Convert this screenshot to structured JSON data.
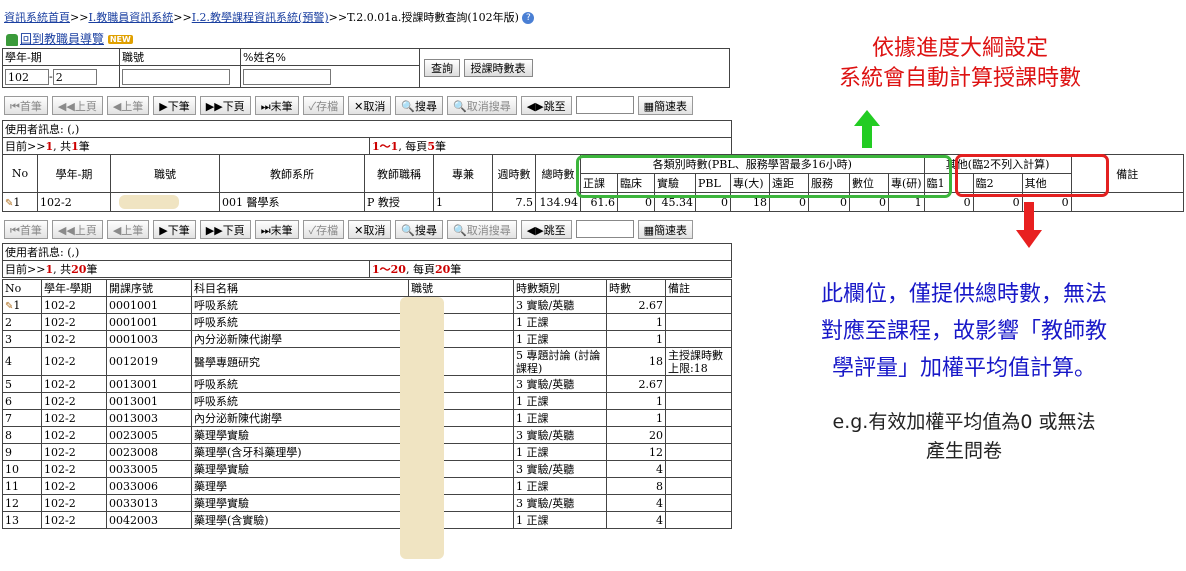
{
  "breadcrumb": {
    "items": [
      "資訊系統首頁",
      "I.教職員資訊系統",
      "I.2.教學課程資訊系統(預警)"
    ],
    "separator": ">>",
    "current": ">>T.2.0.01a.授課時數查詢(102年版)"
  },
  "back_link": {
    "label": "回到教職員導覽",
    "badge": "NEW"
  },
  "query": {
    "headers": [
      "學年-期",
      "職號",
      "%姓名%"
    ],
    "year_value": "102",
    "term_value": "2",
    "term_prefix": "-",
    "buttons": [
      "查詢",
      "授課時數表"
    ]
  },
  "toolbar": {
    "first": "首筆",
    "prev_page": "上頁",
    "prev": "上筆",
    "next": "下筆",
    "next_page": "下頁",
    "last": "末筆",
    "save": "存檔",
    "cancel": "取消",
    "search": "搜尋",
    "cancel_search": "取消搜尋",
    "goto": "跳至",
    "quick": "簡速表"
  },
  "top_status": {
    "user_msg": "使用者訊息: (,)",
    "position_prefix": "目前>>",
    "position": "1",
    "total_prefix": ", 共",
    "total": "1",
    "total_suffix": "筆",
    "range": "1～1",
    "per_page_prefix": ", 每頁",
    "per_page": "5",
    "per_page_suffix": "筆"
  },
  "teacher_table": {
    "headers": {
      "no": "No",
      "term": "學年-期",
      "id": "職號",
      "dept": "教師系所",
      "title": "教師職稱",
      "fulltime": "專兼",
      "week_hours": "週時數",
      "total_hours": "總時數",
      "group1": "各類別時數(PBL、服務學習最多16小時)",
      "group2": "其他(臨2不列入計算)",
      "remark": "備註"
    },
    "sub_headers1": [
      "正課",
      "臨床",
      "實驗",
      "PBL",
      "專(大)",
      "遠距",
      "服務",
      "數位",
      "專(研)"
    ],
    "sub_headers2": [
      "臨1",
      "臨2",
      "其他"
    ],
    "row": {
      "no": "1",
      "term": "102-2",
      "id": "",
      "dept": "001 醫學系",
      "title": "P 教授",
      "fulltime": "1",
      "week_hours": "7.5",
      "total_hours": "134.94",
      "cat": [
        "61.6",
        "0",
        "45.34",
        "0",
        "18",
        "0",
        "0",
        "0",
        "1"
      ],
      "other": [
        "0",
        "0",
        "0"
      ]
    }
  },
  "bottom_status": {
    "user_msg": "使用者訊息: (,)",
    "position_prefix": "目前>>",
    "position": "1",
    "total_prefix": ", 共",
    "total": "20",
    "total_suffix": "筆",
    "range": "1～20",
    "per_page_prefix": ", 每頁",
    "per_page": "20",
    "per_page_suffix": "筆"
  },
  "course_table": {
    "headers": [
      "No",
      "學年-學期",
      "開課序號",
      "科目名稱",
      "職號",
      "時數類別",
      "時數",
      "備註"
    ],
    "rows": [
      {
        "no": "1",
        "term": "102-2",
        "code": "0001001",
        "name": "呼吸系統",
        "type": "3 實驗/英聽",
        "hours": "2.67",
        "note": ""
      },
      {
        "no": "2",
        "term": "102-2",
        "code": "0001001",
        "name": "呼吸系統",
        "type": "1 正課",
        "hours": "1",
        "note": ""
      },
      {
        "no": "3",
        "term": "102-2",
        "code": "0001003",
        "name": "內分泌新陳代謝學",
        "type": "1 正課",
        "hours": "1",
        "note": ""
      },
      {
        "no": "4",
        "term": "102-2",
        "code": "0012019",
        "name": "醫學專題研究",
        "type": "5 專題討論 (討論課程)",
        "hours": "18",
        "note": "主授課時數上限:18"
      },
      {
        "no": "5",
        "term": "102-2",
        "code": "0013001",
        "name": "呼吸系統",
        "type": "3 實驗/英聽",
        "hours": "2.67",
        "note": ""
      },
      {
        "no": "6",
        "term": "102-2",
        "code": "0013001",
        "name": "呼吸系統",
        "type": "1 正課",
        "hours": "1",
        "note": ""
      },
      {
        "no": "7",
        "term": "102-2",
        "code": "0013003",
        "name": "內分泌新陳代謝學",
        "type": "1 正課",
        "hours": "1",
        "note": ""
      },
      {
        "no": "8",
        "term": "102-2",
        "code": "0023005",
        "name": "藥理學實驗",
        "type": "3 實驗/英聽",
        "hours": "20",
        "note": ""
      },
      {
        "no": "9",
        "term": "102-2",
        "code": "0023008",
        "name": "藥理學(含牙科藥理學)",
        "type": "1 正課",
        "hours": "12",
        "note": ""
      },
      {
        "no": "10",
        "term": "102-2",
        "code": "0033005",
        "name": "藥理學實驗",
        "type": "3 實驗/英聽",
        "hours": "4",
        "note": ""
      },
      {
        "no": "11",
        "term": "102-2",
        "code": "0033006",
        "name": "藥理學",
        "type": "1 正課",
        "hours": "8",
        "note": ""
      },
      {
        "no": "12",
        "term": "102-2",
        "code": "0033013",
        "name": "藥理學實驗",
        "type": "3 實驗/英聽",
        "hours": "4",
        "note": ""
      },
      {
        "no": "13",
        "term": "102-2",
        "code": "0042003",
        "name": "藥理學(含實驗)",
        "type": "1 正課",
        "hours": "4",
        "note": ""
      }
    ]
  },
  "annotations": {
    "red_line1": "依據進度大綱設定",
    "red_line2": "系統會自動計算授課時數",
    "blue_line1": "此欄位，僅提供總時數，無法",
    "blue_line2": "對應至課程，故影響「教師教",
    "blue_line3": "學評量」加權平均值計算。",
    "example_line1": "e.g.有效加權平均值為0 或無法",
    "example_line2": "產生問卷"
  },
  "colors": {
    "link": "#1a3fa0",
    "green": "#3cb53c",
    "red": "#e32020",
    "blue_text": "#1818c8",
    "red_text": "#d11111"
  }
}
